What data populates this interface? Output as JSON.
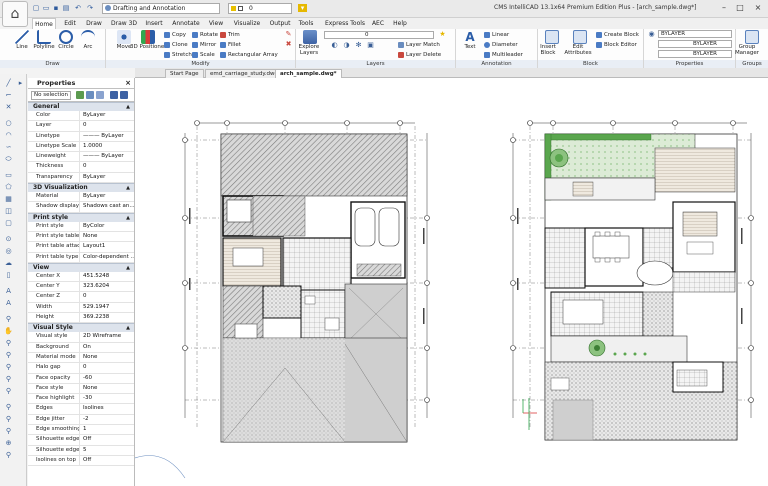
{
  "app_title": "CMS IntelliCAD 13.1x64 Premium Edition Plus - [arch_sample.dwg*]",
  "workspace": "Drafting and Annotation",
  "layer_quick": "0",
  "menu_tabs": [
    "Home",
    "Edit",
    "Draw",
    "Draw 3D",
    "Insert",
    "Annotate",
    "View",
    "Visualize",
    "Output",
    "Tools",
    "Express Tools",
    "AEC",
    "Help"
  ],
  "ribbon": {
    "draw": {
      "label": "Draw",
      "line": "Line",
      "polyline": "Polyline",
      "circle": "Circle",
      "arc": "Arc"
    },
    "modify": {
      "label": "Modify",
      "move": "Move",
      "positioner": "3D Positioner",
      "copy": "Copy",
      "clone": "Clone",
      "stretch": "Stretch",
      "rotate": "Rotate",
      "mirror": "Mirror",
      "scale": "Scale",
      "trim": "Trim",
      "fillet": "Fillet",
      "rect_array": "Rectangular Array"
    },
    "layers": {
      "label": "Layers",
      "explore": "Explore Layers",
      "layer_value": "0",
      "layer_match": "Layer Match",
      "layer_delete": "Layer Delete"
    },
    "annotation": {
      "label": "Annotation",
      "text": "Text",
      "linear": "Linear",
      "diameter": "Diameter",
      "multileader": "Multileader"
    },
    "block": {
      "label": "Block",
      "insert": "Insert Block",
      "edit": "Edit Attributes",
      "create": "Create Block",
      "editor": "Block Editor"
    },
    "properties": {
      "label": "Properties",
      "color": "BYLAYER",
      "linetype": "BYLAYER",
      "lineweight": "BYLAYER"
    },
    "groups": {
      "label": "Groups",
      "group_manager": "Group Manager"
    }
  },
  "doc_tabs": [
    "Start Page",
    "emd_carriage_study.dwg*",
    "arch_sample.dwg*"
  ],
  "properties": {
    "title": "Properties",
    "selection": "No selection",
    "sections": [
      {
        "name": "General",
        "rows": [
          [
            "Color",
            "ByLayer"
          ],
          [
            "Layer",
            "0"
          ],
          [
            "Linetype",
            "——— ByLayer"
          ],
          [
            "Linetype Scale",
            "1.0000"
          ],
          [
            "Lineweight",
            "——— ByLayer"
          ],
          [
            "Thickness",
            "0"
          ],
          [
            "Transparency",
            "ByLayer"
          ]
        ]
      },
      {
        "name": "3D Visualization",
        "rows": [
          [
            "Material",
            "ByLayer"
          ],
          [
            "Shadow display",
            "Shadows cast an..."
          ]
        ]
      },
      {
        "name": "Print style",
        "rows": [
          [
            "Print style",
            "ByColor"
          ],
          [
            "Print style table",
            "None"
          ],
          [
            "Print table attach...",
            "Layout1"
          ],
          [
            "Print table type",
            "Color-dependent ..."
          ]
        ]
      },
      {
        "name": "View",
        "rows": [
          [
            "Center X",
            "451.5248"
          ],
          [
            "Center Y",
            "323.6204"
          ],
          [
            "Center Z",
            "0"
          ],
          [
            "Width",
            "529.1947"
          ],
          [
            "Height",
            "369.2238"
          ]
        ]
      },
      {
        "name": "Visual Style",
        "rows": [
          [
            "Visual style",
            "2D Wireframe"
          ],
          [
            "Background",
            "On"
          ],
          [
            "Material mode",
            "None"
          ],
          [
            "Halo gap",
            "0"
          ],
          [
            "Face opacity",
            "-60"
          ],
          [
            "Face style",
            "None"
          ],
          [
            "Face highlight",
            "-30"
          ],
          [
            "Edges",
            "Isolines"
          ],
          [
            "Edge jitter",
            "-2"
          ],
          [
            "Edge smoothing",
            "1"
          ],
          [
            "Silhouette edges",
            "Off"
          ],
          [
            "Silhouette edge ...",
            "5"
          ],
          [
            "Isolines on top",
            "Off"
          ]
        ]
      }
    ]
  },
  "colors": {
    "ribbon_label": "#e9eef5",
    "section": "#dde3ec",
    "hatch": "#8c8c8c",
    "grass": "#5aa64e"
  }
}
